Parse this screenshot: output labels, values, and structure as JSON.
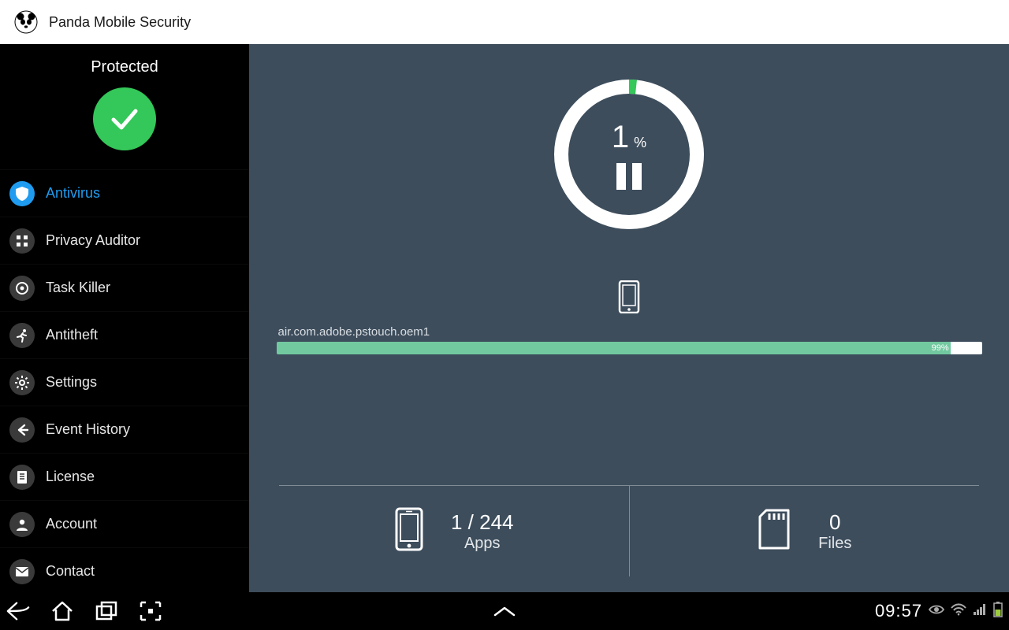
{
  "app": {
    "title": "Panda Mobile Security"
  },
  "sidebar": {
    "status": "Protected",
    "items": [
      {
        "label": "Antivirus",
        "icon": "shield",
        "active": true
      },
      {
        "label": "Privacy Auditor",
        "icon": "grid",
        "active": false
      },
      {
        "label": "Task Killer",
        "icon": "target",
        "active": false
      },
      {
        "label": "Antitheft",
        "icon": "runner",
        "active": false
      },
      {
        "label": "Settings",
        "icon": "gear",
        "active": false
      },
      {
        "label": "Event History",
        "icon": "arrow-left",
        "active": false
      },
      {
        "label": "License",
        "icon": "document",
        "active": false
      },
      {
        "label": "Account",
        "icon": "person",
        "active": false
      },
      {
        "label": "Contact",
        "icon": "mail",
        "active": false
      }
    ]
  },
  "scan": {
    "percent": "1",
    "percent_unit": "%",
    "current_item": "air.com.adobe.pstouch.oem1",
    "progress_percent": 99,
    "progress_label": "99%"
  },
  "stats": {
    "apps": {
      "value": "1 / 244",
      "label": "Apps"
    },
    "files": {
      "value": "0",
      "label": "Files"
    }
  },
  "statusbar": {
    "time": "09:57"
  },
  "colors": {
    "sidebar_bg": "#000000",
    "main_bg": "#3d4d5c",
    "accent": "#1f9cf0",
    "success": "#34c759",
    "progress": "#72c9a0"
  }
}
